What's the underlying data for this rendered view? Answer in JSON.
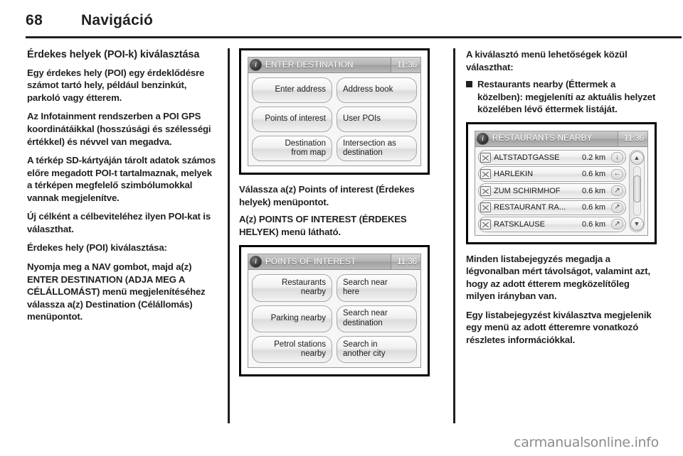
{
  "header": {
    "page_number": "68",
    "chapter_title": "Navigáció"
  },
  "footer": {
    "watermark": "carmanualsonline.info"
  },
  "column_left": {
    "section_title": "Érdekes helyek (POI-k) kiválasztása",
    "paragraphs": [
      "Egy érdekes hely (POI) egy érdeklődésre számot tartó hely, például benzinkút, parkoló vagy étterem.",
      "Az Infotainment rendszerben a POI GPS koordinátáikkal (hosszúsági és szélességi értékkel) és névvel van megadva.",
      "A térkép SD-kártyáján tárolt adatok számos előre megadott POI-t tartalmaznak, melyek a térképen megfelelő szimbólumokkal vannak megjelenítve.",
      "Új célként a célbeviteléhez ilyen POI-kat is választhat."
    ],
    "subsection_title": "Érdekes hely (POI) kiválasztása:",
    "instruction": "Nyomja meg a NAV gombot, majd a(z) ENTER DESTINATION (ADJA MEG A CÉLÁLLOMÁST) menü megjelenítéséhez válassza a(z) Destination (Célállomás) menüpontot."
  },
  "column_middle": {
    "screen_enter_destination": {
      "title": "ENTER DESTINATION",
      "clock": "11:36",
      "info_icon": "info-icon",
      "buttons": [
        {
          "label": "Enter address",
          "align": "right"
        },
        {
          "label": "Address book",
          "align": "left"
        },
        {
          "label": "Points of interest",
          "align": "right"
        },
        {
          "label": "User POIs",
          "align": "left"
        },
        {
          "label": "Destination\nfrom map",
          "align": "right"
        },
        {
          "label": "Intersection as\ndestination",
          "align": "left"
        }
      ]
    },
    "caption_1": "Válassza a(z) Points of interest (Érdekes helyek) menüpontot.",
    "caption_2": "A(z) POINTS OF INTEREST (ÉRDEKES HELYEK) menü látható.",
    "screen_points_of_interest": {
      "title": "POINTS OF INTEREST",
      "clock": "11:36",
      "info_icon": "info-icon",
      "buttons": [
        {
          "label": "Restaurants\nnearby",
          "align": "right"
        },
        {
          "label": "Search near\nhere",
          "align": "left"
        },
        {
          "label": "Parking nearby",
          "align": "right"
        },
        {
          "label": "Search near\ndestination",
          "align": "left"
        },
        {
          "label": "Petrol stations\nnearby",
          "align": "right"
        },
        {
          "label": "Search in\nanother city",
          "align": "left"
        }
      ]
    }
  },
  "column_right": {
    "intro": "A kiválasztó menü lehetőségek közül választhat:",
    "bullet": "Restaurants nearby (Éttermek a közelben): megjeleníti az aktuális helyzet közelében lévő éttermek listáját.",
    "screen_restaurants_nearby": {
      "title": "RESTAURANTS NEARBY",
      "clock": "11:36",
      "info_icon": "info-icon",
      "rows": [
        {
          "icon": "poi-marker-icon",
          "name": "ALTSTADTGASSE",
          "distance": "0.2 km",
          "direction": "↓"
        },
        {
          "icon": "poi-marker-icon",
          "name": "HARLEKIN",
          "distance": "0.6 km",
          "direction": "←"
        },
        {
          "icon": "poi-marker-icon",
          "name": "ZUM SCHIRMHOF",
          "distance": "0.6 km",
          "direction": "↗"
        },
        {
          "icon": "poi-marker-icon",
          "name": "RESTAURANT RA...",
          "distance": "0.6 km",
          "direction": "↗"
        },
        {
          "icon": "poi-marker-icon",
          "name": "RATSKLAUSE",
          "distance": "0.6 km",
          "direction": "↗"
        }
      ],
      "scroll_up_icon": "chevron-up-icon",
      "scroll_down_icon": "chevron-down-icon"
    },
    "paragraphs": [
      "Minden listabejegyzés megadja a légvonalban mért távolságot, valamint azt, hogy az adott étterem megközelítőleg milyen irányban van.",
      "Egy listabejegyzést kiválasztva megjelenik egy menü az adott étteremre vonatkozó részletes információkkal."
    ]
  }
}
